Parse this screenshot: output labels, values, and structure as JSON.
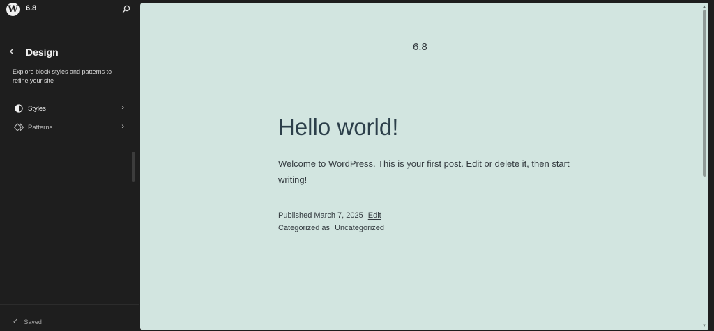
{
  "header": {
    "site_title": "6.8",
    "logo_letter": "W"
  },
  "sidebar": {
    "title": "Design",
    "description": "Explore block styles and patterns to refine your site",
    "items": [
      {
        "label": "Styles",
        "icon": "half-circle-icon"
      },
      {
        "label": "Patterns",
        "icon": "diamond-icon"
      }
    ],
    "saved_label": "Saved"
  },
  "preview": {
    "site_title": "6.8",
    "post_title": "Hello world!",
    "post_body": "Welcome to WordPress. This is your first post. Edit or delete it, then start writing!",
    "published_prefix": "Published",
    "published_date": "March 7, 2025",
    "edit_label": "Edit",
    "categorized_prefix": "Categorized as",
    "category": "Uncategorized",
    "background_color": "#d2e5e0"
  },
  "colors": {
    "sidebar_bg": "#1e1e1e",
    "text_light": "#f0f0f0"
  }
}
